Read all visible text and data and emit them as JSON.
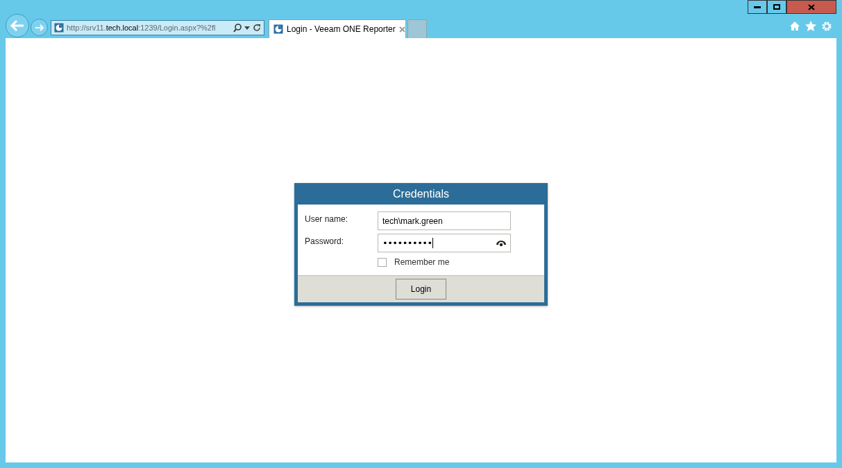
{
  "browser": {
    "address": "http://srv11.**tech.local**:1239/Login.aspx?%2fl",
    "tabs": [
      {
        "label": "Login - Veeam ONE Reporter",
        "selected": true
      }
    ]
  },
  "dialog": {
    "title": "Credentials",
    "fields": [
      {
        "label": "User name:",
        "value": "tech\\mark.green",
        "kind": "text"
      },
      {
        "label": "Password:",
        "value": "••••••••••",
        "kind": "password"
      }
    ],
    "remember": {
      "label": "Remember me",
      "checked": false
    },
    "button": "Login"
  }
}
